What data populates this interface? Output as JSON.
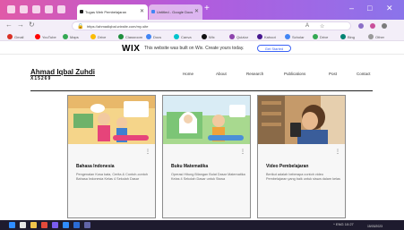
{
  "browser": {
    "tabs": [
      {
        "label": "Tugas Web Pembelajaran",
        "active": true
      },
      {
        "label": "Untitled - Google Docs",
        "active": false
      }
    ],
    "new_tab": "+",
    "window_controls": {
      "minimize": "–",
      "maximize": "□",
      "close": "✕"
    },
    "url": "https://ahmadiqbal.wixsite.com/my-site",
    "bookmarks": [
      {
        "label": "Gmail",
        "color": "#d93025"
      },
      {
        "label": "YouTube",
        "color": "#ff0000"
      },
      {
        "label": "Maps",
        "color": "#34a853"
      },
      {
        "label": "Drive",
        "color": "#fbbc05"
      },
      {
        "label": "Classroom",
        "color": "#1e8e3e"
      },
      {
        "label": "Docs",
        "color": "#4285f4"
      },
      {
        "label": "Canva",
        "color": "#00c4cc"
      },
      {
        "label": "Wix",
        "color": "#111111"
      },
      {
        "label": "Quizizz",
        "color": "#8e44ad"
      },
      {
        "label": "Kahoot",
        "color": "#46178f"
      },
      {
        "label": "Scholar",
        "color": "#4285f4"
      },
      {
        "label": "Drive",
        "color": "#34a853"
      },
      {
        "label": "Bing",
        "color": "#008373"
      },
      {
        "label": "Other",
        "color": "#999999"
      }
    ]
  },
  "wix_banner": {
    "logo": "WIX",
    "message": "This website was built on Wix. Create yours today.",
    "button": "Get Started"
  },
  "site": {
    "name": "Ahmad Iqbal Zuhdi",
    "id": "X15269",
    "menu": [
      "Home",
      "About",
      "Research",
      "Publications",
      "Post",
      "Contact"
    ]
  },
  "cards": [
    {
      "title": "Bahasa Indonesia",
      "description": "Pengenalan Kosa kata, Cerita & Contoh-contoh Bahasa Indonesia Kelas 4 Sekolah Dasar",
      "more": "⋮",
      "thumb_bg": "#f5d58a",
      "accent": "#e6447a"
    },
    {
      "title": "Buku Matematika",
      "description": "Operasi Hitung Bilangan Bulat Dasar Matematika Kelas 4 Sekolah Dasar untuk Siswa",
      "more": "⋮",
      "thumb_bg": "#7cc576",
      "accent": "#4b8fd8"
    },
    {
      "title": "Video Pembelajaran",
      "description": "Berikut adalah beberapa contoh video Pembelajaran yang baik untuk siswa dalam kelas",
      "more": "⋮",
      "thumb_bg": "#c59a6a",
      "accent": "#3a5d9a"
    }
  ],
  "taskbar": {
    "icons": [
      {
        "name": "windows",
        "color": "#2f8cff"
      },
      {
        "name": "search",
        "color": "#e6e6e6"
      },
      {
        "name": "files",
        "color": "#f0c44b"
      },
      {
        "name": "chrome",
        "color": "#e24a3b"
      },
      {
        "name": "store",
        "color": "#7a5cf0"
      },
      {
        "name": "mail",
        "color": "#2f8cff"
      },
      {
        "name": "word",
        "color": "#2b6cd6"
      },
      {
        "name": "teams",
        "color": "#6264a7"
      }
    ],
    "tray": "^  ENG  10:27",
    "date": "15/03/2023"
  }
}
